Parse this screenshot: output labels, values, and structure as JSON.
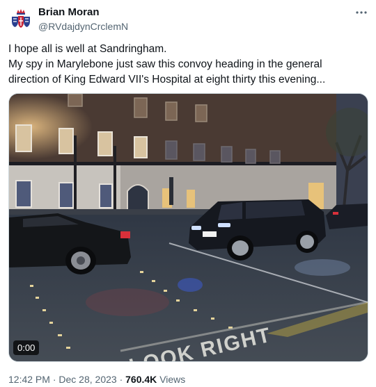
{
  "author": {
    "display_name": "Brian Moran",
    "handle": "@RVdajdynCrclemN",
    "avatar_icon": "crown-crest-icon"
  },
  "more_icon": "more-horizontal-icon",
  "tweet": {
    "lines": [
      "I hope all is well at Sandringham.",
      "My spy in Marylebone just saw this convoy heading in the general",
      "direction of King Edward VII's Hospital at eight thirty this evening..."
    ]
  },
  "media": {
    "type": "video",
    "duration": "0:00",
    "road_marking_text": "LOOK RIGHT"
  },
  "meta": {
    "time": "12:42 PM",
    "separator": "·",
    "date": "Dec 28, 2023",
    "views_count": "760.4K",
    "views_label": "Views"
  },
  "colors": {
    "text_primary": "#0f1419",
    "text_secondary": "#536471",
    "crest_blue": "#2a3f8f",
    "crest_red": "#c8283a"
  }
}
